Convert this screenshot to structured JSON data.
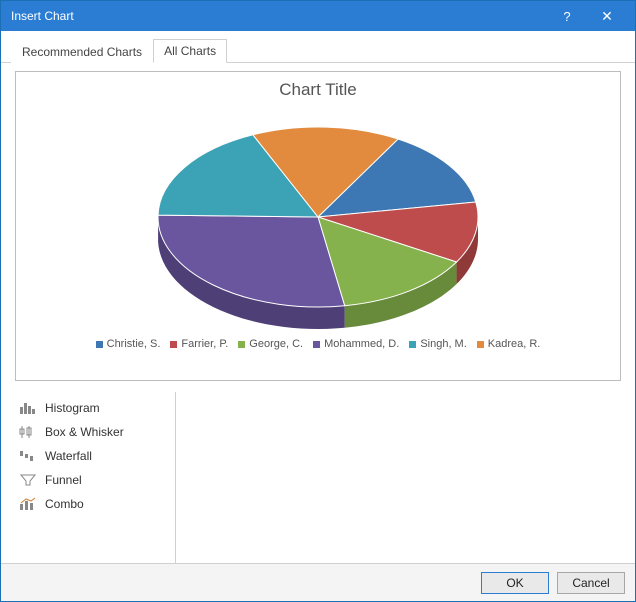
{
  "window": {
    "title": "Insert Chart",
    "help_label": "?",
    "close_label": "✕"
  },
  "tabs": {
    "recommended": "Recommended Charts",
    "all": "All Charts"
  },
  "variant_thumb_name": "pie-3d-variant",
  "chart_data": {
    "type": "pie",
    "title": "Chart Title",
    "series": [
      {
        "name": "Christie, S.",
        "value": 14,
        "color": "#3d78b4",
        "side": "#2f5d8c"
      },
      {
        "name": "Farrier, P.",
        "value": 11,
        "color": "#bf4c4c",
        "side": "#8f3939"
      },
      {
        "name": "George, C.",
        "value": 14,
        "color": "#86b24d",
        "side": "#678a3b"
      },
      {
        "name": "Mohammed, D.",
        "value": 28,
        "color": "#6a569e",
        "side": "#4f3f77"
      },
      {
        "name": "Singh, M.",
        "value": 18,
        "color": "#3ca2b5",
        "side": "#2f7d8c"
      },
      {
        "name": "Kadrea, R.",
        "value": 15,
        "color": "#e28b3e",
        "side": "#b06c2f"
      }
    ]
  },
  "sidebar": {
    "items": [
      {
        "label": "Histogram",
        "icon": "histogram-icon"
      },
      {
        "label": "Box & Whisker",
        "icon": "box-whisker-icon"
      },
      {
        "label": "Waterfall",
        "icon": "waterfall-icon"
      },
      {
        "label": "Funnel",
        "icon": "funnel-icon"
      },
      {
        "label": "Combo",
        "icon": "combo-icon"
      }
    ]
  },
  "footer": {
    "ok": "OK",
    "cancel": "Cancel"
  }
}
